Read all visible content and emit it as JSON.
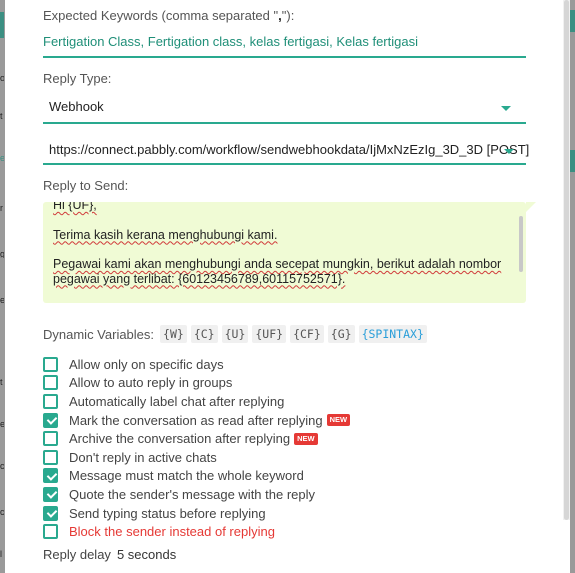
{
  "keywords": {
    "label_prefix": "Expected Keywords (comma separated \"",
    "label_comma": ",",
    "label_suffix": "\"):",
    "value": "Fertigation Class, Fertigation class, kelas fertigasi, Kelas fertigasi"
  },
  "reply_type": {
    "label": "Reply Type:",
    "value": "Webhook",
    "url": "https://connect.pabbly.com/workflow/sendwebhookdata/IjMxNzEzIg_3D_3D [POST]"
  },
  "reply_to_send": {
    "label": "Reply to Send:",
    "line1": "Hi {UF},",
    "line2": "Terima kasih kerana menghubungi kami.",
    "line3": "Pegawai kami akan menghubungi anda secepat mungkin, berikut adalah nombor",
    "line4": "pegawai yang terlibat: {60123456789,60115752571}."
  },
  "dynamic_variables": {
    "label": "Dynamic Variables:",
    "chips": [
      "{W}",
      "{C}",
      "{U}",
      "{UF}",
      "{CF}",
      "{G}",
      "{SPINTAX}"
    ]
  },
  "options": [
    {
      "label": "Allow only on specific days",
      "checked": false
    },
    {
      "label": "Allow to auto reply in groups",
      "checked": false
    },
    {
      "label": "Automatically label chat after replying",
      "checked": false
    },
    {
      "label": "Mark the conversation as read after replying",
      "checked": true,
      "badge": "NEW"
    },
    {
      "label": "Archive the conversation after replying",
      "checked": false,
      "badge": "NEW"
    },
    {
      "label": "Don't reply in active chats",
      "checked": false
    },
    {
      "label": "Message must match the whole keyword",
      "checked": true
    },
    {
      "label": "Quote the sender's message with the reply",
      "checked": true
    },
    {
      "label": "Send typing status before replying",
      "checked": true
    },
    {
      "label": "Block the sender instead of replying",
      "checked": false,
      "danger": true
    }
  ],
  "reply_delay": {
    "label": "Reply delay",
    "value": "5 seconds"
  },
  "colors": {
    "accent": "#29a98f",
    "reply_bg": "#f0fbd5",
    "danger": "#e53935"
  }
}
